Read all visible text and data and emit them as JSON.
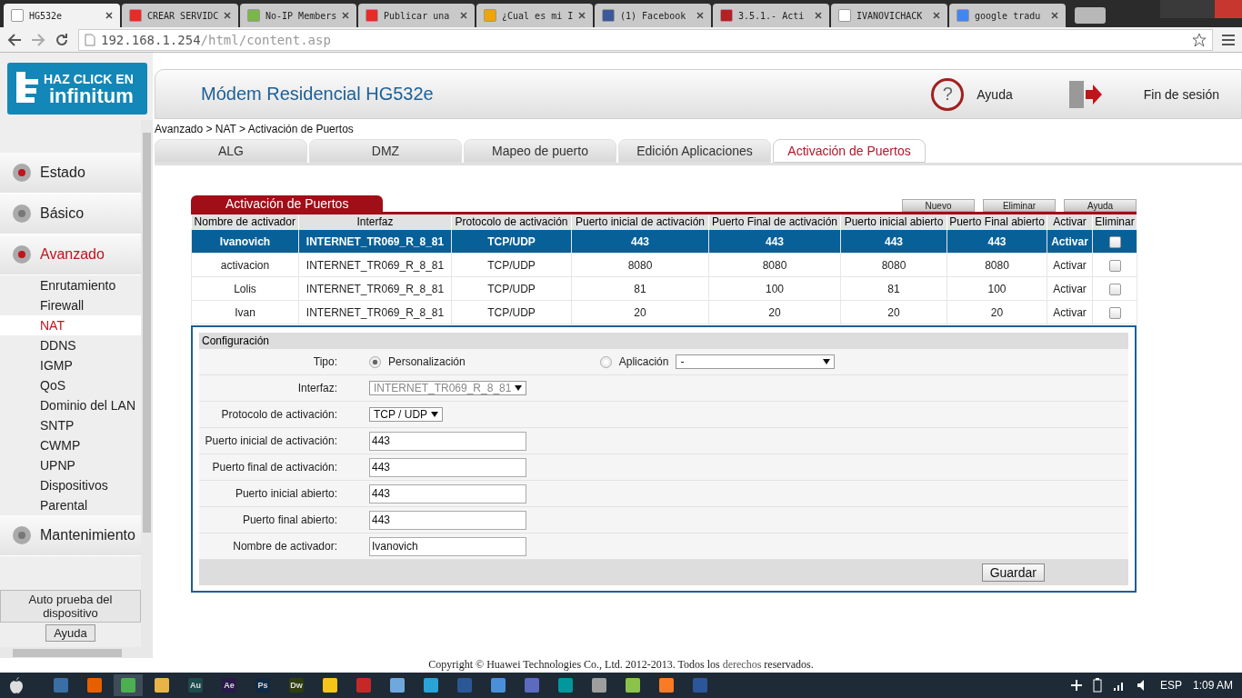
{
  "browser": {
    "tabs": [
      {
        "title": "HG532e",
        "selected": true,
        "color": "#ffffff"
      },
      {
        "title": "CREAR SERVIDC",
        "selected": false,
        "color": "#e52d27"
      },
      {
        "title": "No-IP Members",
        "selected": false,
        "color": "#7ab648"
      },
      {
        "title": "Publicar una",
        "selected": false,
        "color": "#e52d27"
      },
      {
        "title": "¿Cual es mi I",
        "selected": false,
        "color": "#f0a30a"
      },
      {
        "title": "(1) Facebook",
        "selected": false,
        "color": "#3b5998"
      },
      {
        "title": "3.5.1.- Acti",
        "selected": false,
        "color": "#b22222"
      },
      {
        "title": "IVANOVICHACK",
        "selected": false,
        "color": "#ffffff"
      },
      {
        "title": "google tradu",
        "selected": false,
        "color": "#4285f4"
      }
    ],
    "url_host": "192.168.1.254",
    "url_path": "/html/content.asp"
  },
  "logo": {
    "line1": "HAZ CLICK EN",
    "line2": "infinitum"
  },
  "header": {
    "title": "Módem Residencial HG532e",
    "help_glyph": "?",
    "help": "Ayuda",
    "logout": "Fin de sesión"
  },
  "breadcrumb": "Avanzado > NAT > Activación de Puertos",
  "sidebar": {
    "sections": [
      {
        "label": "Estado",
        "selected": false
      },
      {
        "label": "Básico",
        "selected": false
      },
      {
        "label": "Avanzado",
        "selected": true,
        "children": [
          {
            "label": "Enrutamiento",
            "selected": false
          },
          {
            "label": "Firewall",
            "selected": false
          },
          {
            "label": "NAT",
            "selected": true
          },
          {
            "label": "DDNS",
            "selected": false
          },
          {
            "label": "IGMP",
            "selected": false
          },
          {
            "label": "QoS",
            "selected": false
          },
          {
            "label": "Dominio del LAN",
            "selected": false
          },
          {
            "label": "SNTP",
            "selected": false
          },
          {
            "label": "CWMP",
            "selected": false
          },
          {
            "label": "UPNP",
            "selected": false
          },
          {
            "label": "Dispositivos",
            "selected": false
          },
          {
            "label": "Parental",
            "selected": false
          }
        ]
      },
      {
        "label": "Mantenimiento",
        "selected": false
      }
    ],
    "self_test": "Auto prueba del dispositivo",
    "help": "Ayuda"
  },
  "page_tabs": [
    {
      "label": "ALG",
      "selected": false
    },
    {
      "label": "DMZ",
      "selected": false
    },
    {
      "label": "Mapeo de puerto",
      "selected": false
    },
    {
      "label": "Edición Aplicaciones",
      "selected": false
    },
    {
      "label": "Activación de Puertos",
      "selected": true
    }
  ],
  "panel": {
    "title": "Activación de Puertos",
    "buttons": [
      "Nuevo",
      "Eliminar",
      "Ayuda"
    ],
    "columns": [
      "Nombre de activador",
      "Interfaz",
      "Protocolo de activación",
      "Puerto inicial de activación",
      "Puerto Final de activación",
      "Puerto inicial abierto",
      "Puerto Final abierto",
      "Activar",
      "Eliminar"
    ],
    "rows": [
      {
        "cells": [
          "Ivanovich",
          "INTERNET_TR069_R_8_81",
          "TCP/UDP",
          "443",
          "443",
          "443",
          "443",
          "Activar"
        ],
        "selected": true,
        "checked": false
      },
      {
        "cells": [
          "activacion",
          "INTERNET_TR069_R_8_81",
          "TCP/UDP",
          "8080",
          "8080",
          "8080",
          "8080",
          "Activar"
        ],
        "selected": false,
        "checked": false
      },
      {
        "cells": [
          "Lolis",
          "INTERNET_TR069_R_8_81",
          "TCP/UDP",
          "81",
          "100",
          "81",
          "100",
          "Activar"
        ],
        "selected": false,
        "checked": false
      },
      {
        "cells": [
          "Ivan",
          "INTERNET_TR069_R_8_81",
          "TCP/UDP",
          "20",
          "20",
          "20",
          "20",
          "Activar"
        ],
        "selected": false,
        "checked": false
      }
    ]
  },
  "config": {
    "title": "Configuración",
    "fields": [
      {
        "kind": "radio",
        "label": "Tipo:",
        "options": [
          {
            "label": "Personalización",
            "selected": true
          },
          {
            "label": "Aplicación",
            "selected": false
          }
        ],
        "value": "-"
      },
      {
        "kind": "select",
        "label": "Interfaz:",
        "value": "INTERNET_TR069_R_8_81",
        "disabled": true
      },
      {
        "kind": "select",
        "label": "Protocolo de activación:",
        "value": "TCP / UDP",
        "disabled": false
      },
      {
        "kind": "text",
        "label": "Puerto inicial de activación:",
        "value": "443"
      },
      {
        "kind": "text",
        "label": "Puerto final de activación:",
        "value": "443"
      },
      {
        "kind": "text",
        "label": "Puerto inicial abierto:",
        "value": "443"
      },
      {
        "kind": "text",
        "label": "Puerto final abierto:",
        "value": "443"
      },
      {
        "kind": "text",
        "label": "Nombre de activador:",
        "value": "Ivanovich"
      }
    ],
    "save": "Guardar"
  },
  "footer": {
    "before": "Copyright © Huawei Technologies Co., Ltd. 2012-2013. Todos los",
    "link": "derechos",
    "after": "reservados."
  },
  "taskbar": {
    "apps": [
      {
        "color": "#3a6ea5",
        "selected": false
      },
      {
        "color": "#e66000",
        "selected": false
      },
      {
        "color": "#4caf50",
        "selected": true
      },
      {
        "color": "#e8b448",
        "selected": false
      },
      {
        "label": "Au",
        "color": "#1d4a4a",
        "selected": false
      },
      {
        "label": "Ae",
        "color": "#2a1a4a",
        "selected": false
      },
      {
        "label": "Ps",
        "color": "#0f2a45",
        "selected": false
      },
      {
        "label": "Dw",
        "color": "#2f3d10",
        "selected": false
      },
      {
        "color": "#f5c518",
        "selected": false
      },
      {
        "color": "#c62828",
        "selected": false
      },
      {
        "color": "#6fa8dc",
        "selected": false
      },
      {
        "color": "#29a3d8",
        "selected": false
      },
      {
        "color": "#2b5797",
        "selected": false
      },
      {
        "color": "#4a90d9",
        "selected": false
      },
      {
        "color": "#5c6bc0",
        "selected": false
      },
      {
        "color": "#00979d",
        "selected": false
      },
      {
        "color": "#9e9e9e",
        "selected": false
      },
      {
        "color": "#8bc34a",
        "selected": false
      },
      {
        "color": "#fb7a24",
        "selected": false
      },
      {
        "color": "#2b579a",
        "selected": false
      }
    ],
    "language": "ESP",
    "time": "1:09 AM"
  }
}
